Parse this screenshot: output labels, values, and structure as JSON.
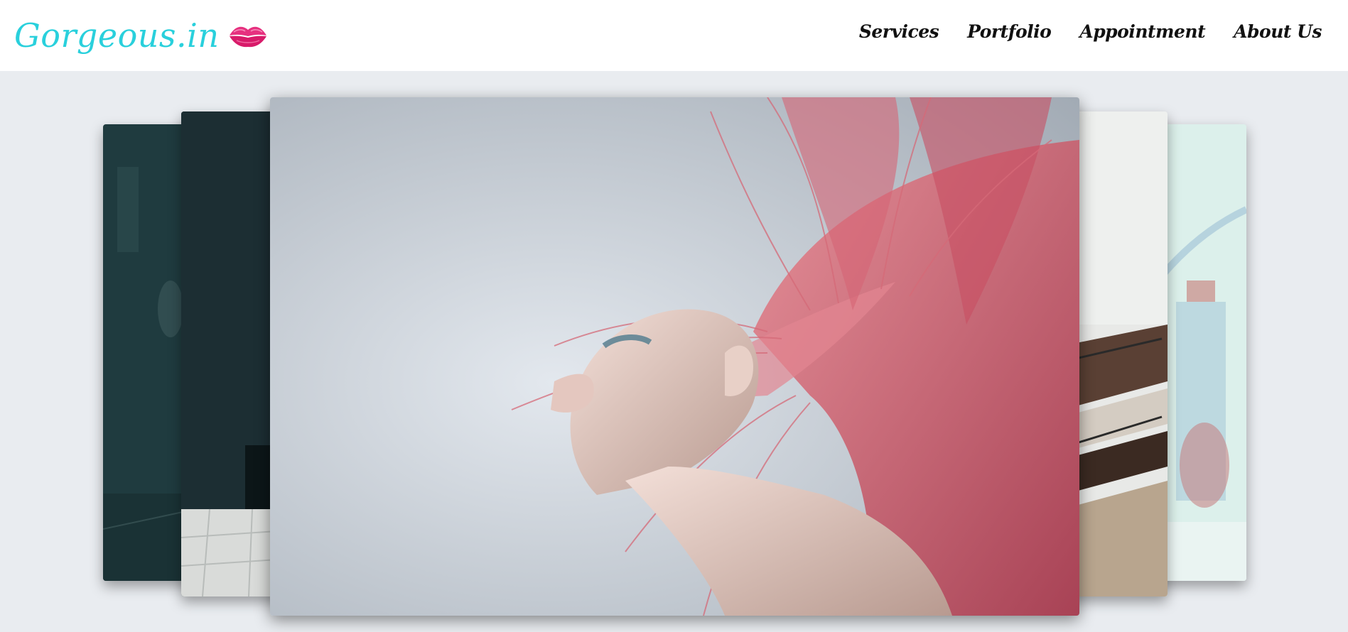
{
  "header": {
    "brand": "Gorgeous.in",
    "brand_color": "#29d0dc",
    "brand_icon": "lips-kiss-icon"
  },
  "nav": {
    "items": [
      {
        "label": "Services"
      },
      {
        "label": "Portfolio"
      },
      {
        "label": "Appointment"
      },
      {
        "label": "About Us"
      }
    ]
  },
  "carousel": {
    "slide_count": 5,
    "active_index": 5,
    "dot_active_color": "#1e88e5"
  }
}
